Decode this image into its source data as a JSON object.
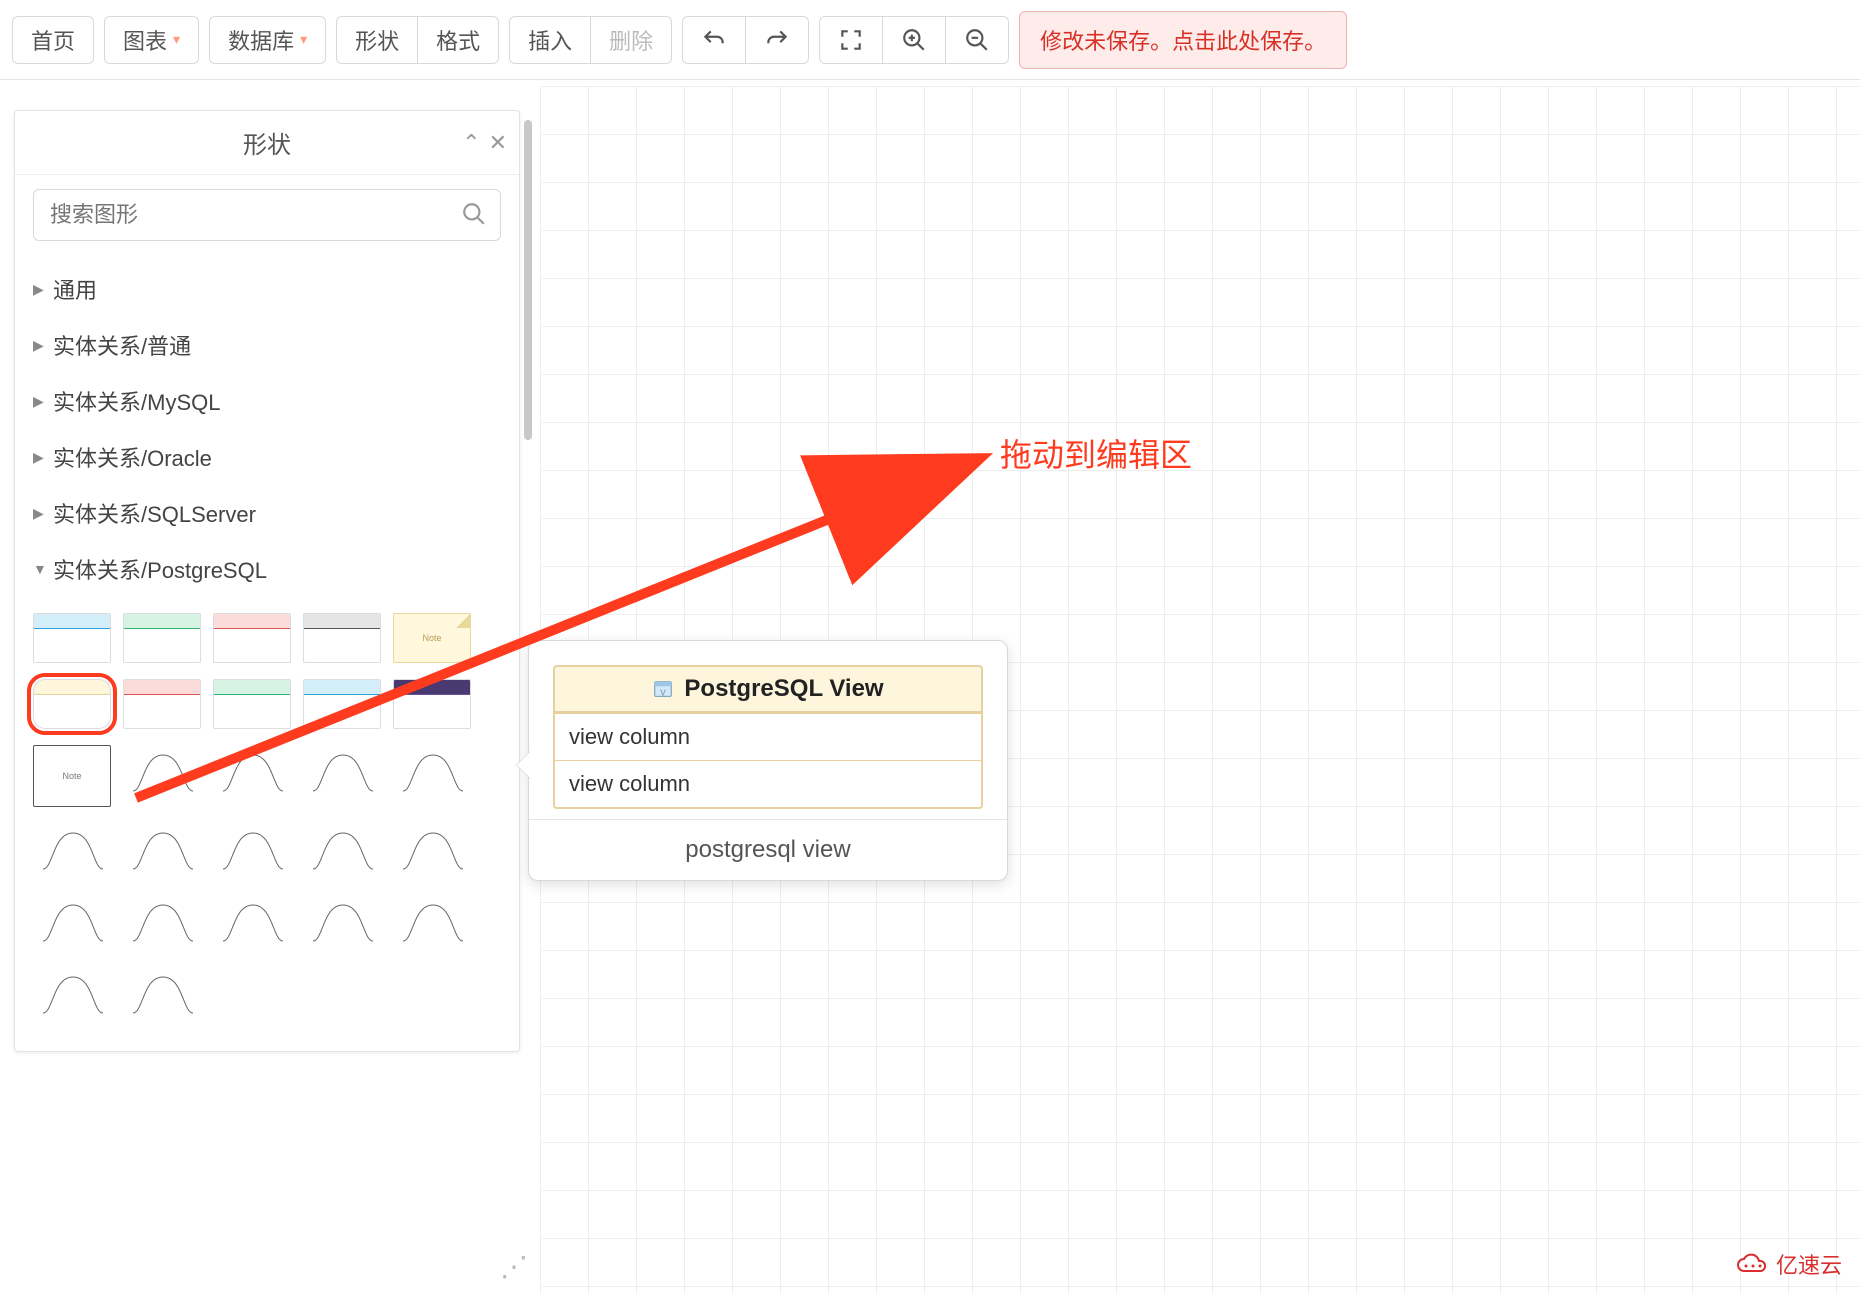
{
  "toolbar": {
    "home": "首页",
    "chart": "图表",
    "database": "数据库",
    "shape": "形状",
    "format": "格式",
    "insert": "插入",
    "delete": "删除"
  },
  "save_notice": "修改未保存。点击此处保存。",
  "panel": {
    "title": "形状",
    "search_placeholder": "搜索图形",
    "categories": [
      {
        "label": "通用",
        "expanded": false
      },
      {
        "label": "实体关系/普通",
        "expanded": false
      },
      {
        "label": "实体关系/MySQL",
        "expanded": false
      },
      {
        "label": "实体关系/Oracle",
        "expanded": false
      },
      {
        "label": "实体关系/SQLServer",
        "expanded": false
      },
      {
        "label": "实体关系/PostgreSQL",
        "expanded": true
      }
    ],
    "row1_colors": [
      "#2aa5d8",
      "#2bb673",
      "#d9534f",
      "#555555"
    ],
    "row2_colors": [
      "#e7cf9f",
      "#d9534f",
      "#2bb673",
      "#2aa5d8",
      "#6a4fa0"
    ],
    "note_label": "Note"
  },
  "popup": {
    "title": "PostgreSQL View",
    "cols": [
      "view column",
      "view column"
    ],
    "caption": "postgresql view"
  },
  "annotation": "拖动到编辑区",
  "watermark": "亿速云"
}
